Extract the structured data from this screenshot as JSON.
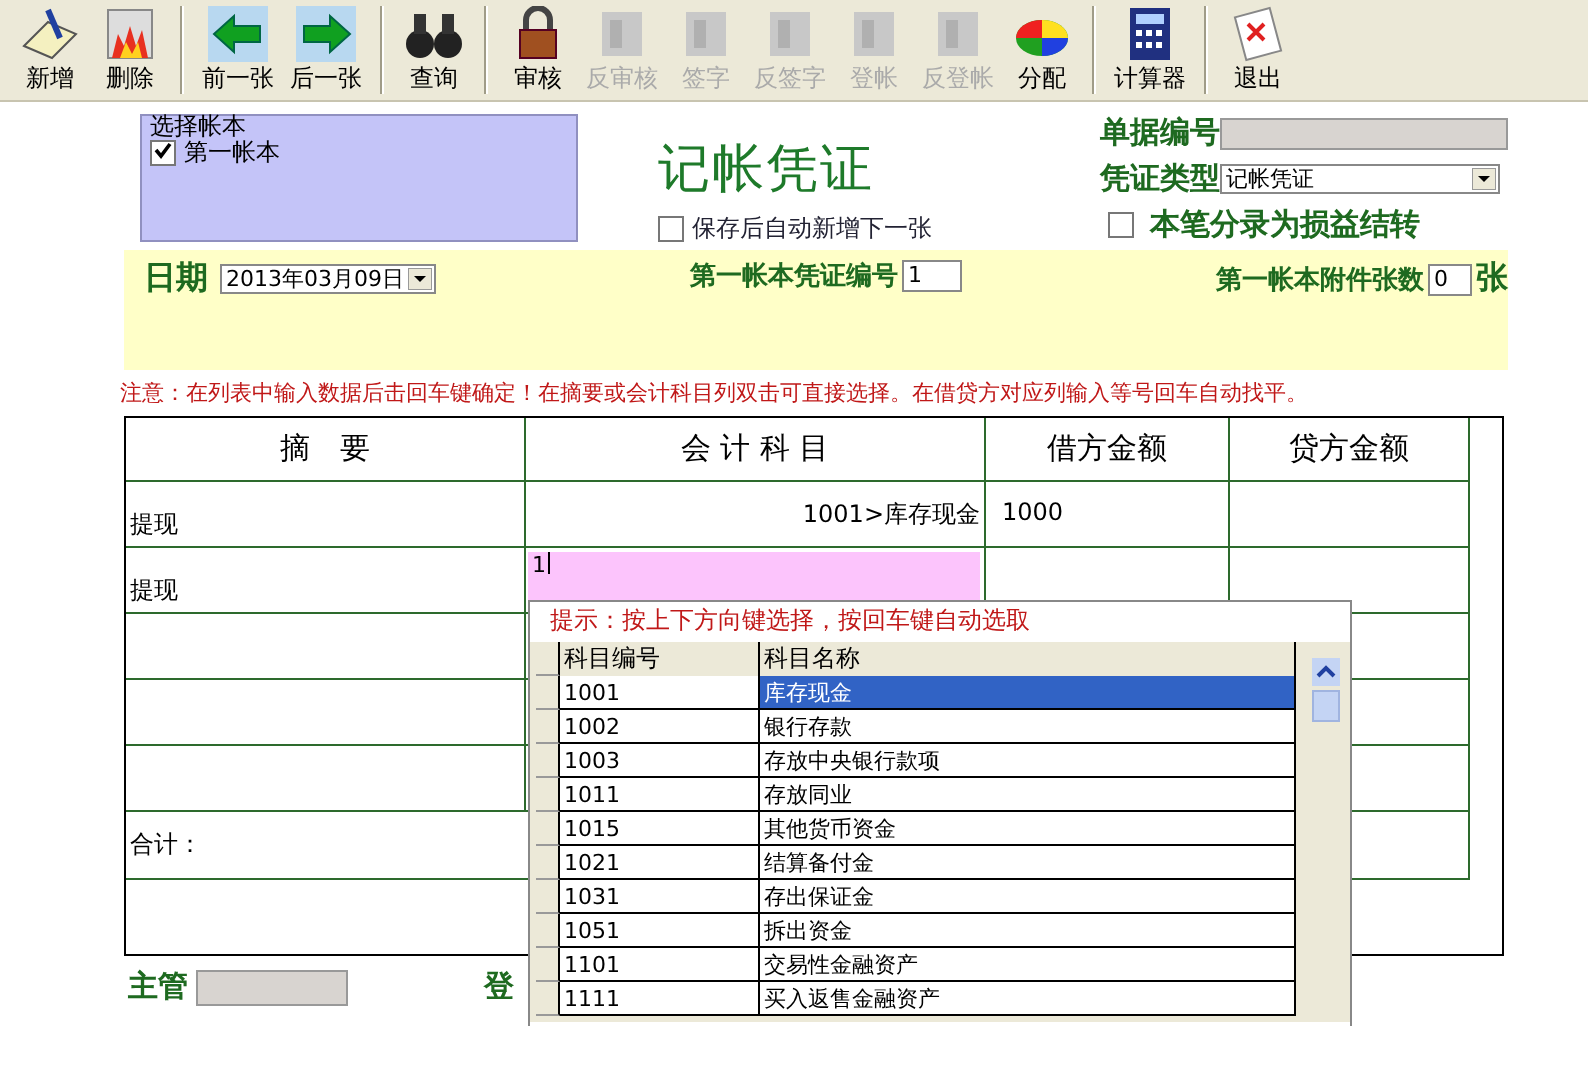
{
  "toolbar": {
    "groups": [
      [
        {
          "label": "新增",
          "disabled": false
        },
        {
          "label": "删除",
          "disabled": false
        }
      ],
      [
        {
          "label": "前一张",
          "disabled": false
        },
        {
          "label": "后一张",
          "disabled": false
        }
      ],
      [
        {
          "label": "查询",
          "disabled": false
        }
      ],
      [
        {
          "label": "审核",
          "disabled": false
        },
        {
          "label": "反审核",
          "disabled": true
        },
        {
          "label": "签字",
          "disabled": true
        },
        {
          "label": "反签字",
          "disabled": true
        },
        {
          "label": "登帐",
          "disabled": true
        },
        {
          "label": "反登帐",
          "disabled": true
        },
        {
          "label": "分配",
          "disabled": false
        }
      ],
      [
        {
          "label": "计算器",
          "disabled": false
        }
      ],
      [
        {
          "label": "退出",
          "disabled": false
        }
      ]
    ]
  },
  "ledger_group": {
    "title": "选择帐本",
    "items": [
      {
        "label": "第一帐本",
        "checked": true
      }
    ]
  },
  "title": "记帐凭证",
  "auto_new": {
    "label": "保存后自动新增下一张",
    "checked": false
  },
  "doc_number": {
    "label": "单据编号"
  },
  "voucher_type": {
    "label": "凭证类型",
    "value": "记帐凭证"
  },
  "profit_loss": {
    "label": "本笔分录为损益结转",
    "checked": false
  },
  "date": {
    "label": "日期",
    "value": "2013年03月09日"
  },
  "voucher_no": {
    "label": "第一帐本凭证编号",
    "value": "1"
  },
  "attachments": {
    "label": "第一帐本附件张数",
    "value": "0",
    "unit": "张"
  },
  "notice": "注意：在列表中输入数据后击回车键确定！在摘要或会计科目列双击可直接选择。在借贷方对应列输入等号回车自动找平。",
  "table": {
    "columns": [
      "摘　要",
      "会 计 科 目",
      "借方金额",
      "贷方金额"
    ],
    "rows": [
      {
        "kind": "entry",
        "summary": "提现",
        "account": "1001>库存现金",
        "debit": "1000",
        "credit": ""
      },
      {
        "kind": "editing",
        "summary": "提现",
        "account": "1",
        "debit": "",
        "credit": ""
      },
      {
        "kind": "blank"
      },
      {
        "kind": "blank"
      },
      {
        "kind": "blank"
      },
      {
        "kind": "total",
        "summary": "合计："
      },
      {
        "kind": "blank"
      }
    ]
  },
  "popup": {
    "hint": "提示：按上下方向键选择，按回车键自动选取",
    "columns": [
      "科目编号",
      "科目名称"
    ],
    "rows": [
      {
        "code": "1001",
        "name": "库存现金",
        "selected": true
      },
      {
        "code": "1002",
        "name": "银行存款",
        "selected": false
      },
      {
        "code": "1003",
        "name": "存放中央银行款项",
        "selected": false
      },
      {
        "code": "1011",
        "name": "存放同业",
        "selected": false
      },
      {
        "code": "1015",
        "name": "其他货币资金",
        "selected": false
      },
      {
        "code": "1021",
        "name": "结算备付金",
        "selected": false
      },
      {
        "code": "1031",
        "name": "存出保证金",
        "selected": false
      },
      {
        "code": "1051",
        "name": "拆出资金",
        "selected": false
      },
      {
        "code": "1101",
        "name": "交易性金融资产",
        "selected": false
      },
      {
        "code": "1111",
        "name": "买入返售金融资产",
        "selected": false
      }
    ]
  },
  "footer": {
    "supervisor": {
      "label": "主管"
    },
    "partial_label": "登"
  }
}
